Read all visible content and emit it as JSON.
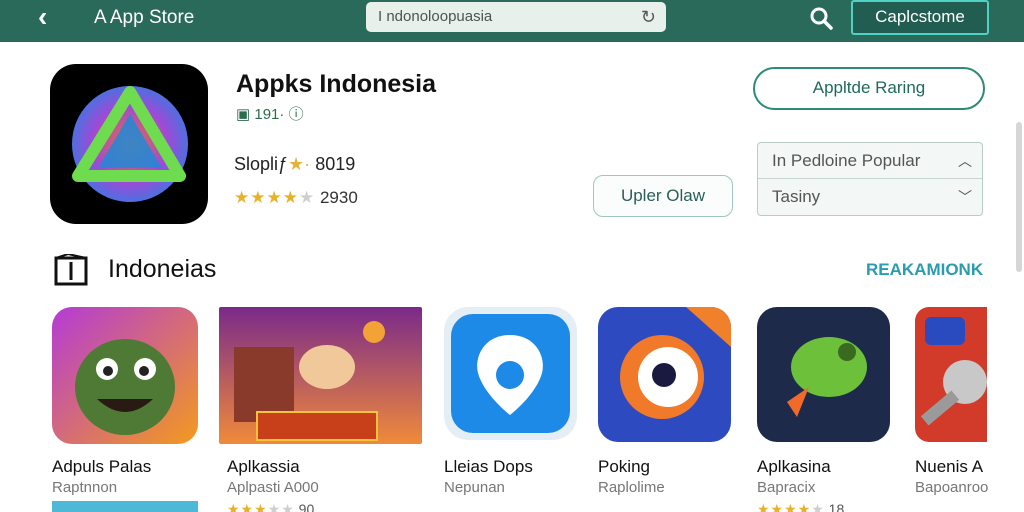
{
  "topbar": {
    "store_title": "A App Store",
    "search_text": "I ndonoloopuasia",
    "account_button": "Caplcstome"
  },
  "hero": {
    "title": "Appks Indonesia",
    "meta": "191·",
    "subtitle": "Slopliƒ",
    "subtitle_value": "8019",
    "rating_count": "2930",
    "rating_stars": 4
  },
  "actions": {
    "primary": "Appltde Raring",
    "secondary": "Upler Olaw"
  },
  "dropdown": {
    "option_1": "In Pedloine Popular",
    "option_2": "Tasiny"
  },
  "section": {
    "title": "Indoneias",
    "see_all": "REAKAMIONK"
  },
  "apps": [
    {
      "name": "Adpuls Palas",
      "developer": "Raptnnon",
      "rating_stars": 0,
      "count": ""
    },
    {
      "name": "Aplkassia",
      "developer": "Aplpasti A000",
      "rating_stars": 3,
      "count": "90"
    },
    {
      "name": "Lleias Dops",
      "developer": "Nepunan",
      "rating_stars": 0,
      "count": ""
    },
    {
      "name": "Poking",
      "developer": "Raplolime",
      "rating_stars": 0,
      "count": ""
    },
    {
      "name": "Aplkasina",
      "developer": "Bapracix",
      "rating_stars": 4,
      "count": "18"
    },
    {
      "name": "Nuenis A",
      "developer": "Bapoanroo",
      "rating_stars": 0,
      "count": ""
    }
  ],
  "colors": {
    "topbar": "#2a6a5a",
    "accent": "#2f8a78",
    "link": "#2a9bb0",
    "star": "#e7b12a"
  },
  "icons": [
    "back-arrow-icon",
    "search-icon",
    "refresh-icon",
    "grid-icon",
    "info-icon",
    "chevron-up-icon",
    "chevron-down-icon",
    "section-icon"
  ]
}
